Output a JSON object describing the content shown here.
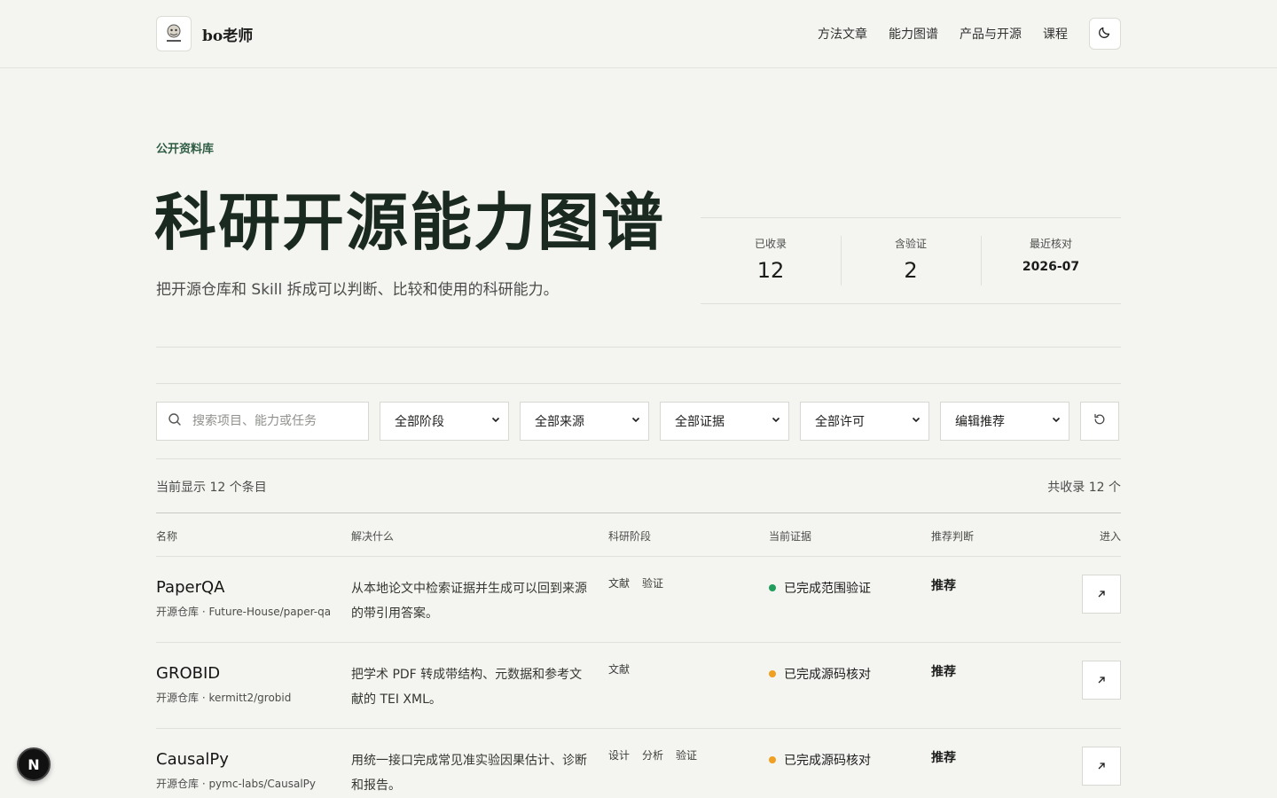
{
  "header": {
    "brand_name": "bo老师",
    "nav": [
      "方法文章",
      "能力图谱",
      "产品与开源",
      "课程"
    ],
    "theme_icon": "moon-icon"
  },
  "hero": {
    "eyebrow": "公开资料库",
    "title": "科研开源能力图谱",
    "subtitle": "把开源仓库和 Skill 拆成可以判断、比较和使用的科研能力。"
  },
  "stats": [
    {
      "label": "已收录",
      "value": "12"
    },
    {
      "label": "含验证",
      "value": "2"
    },
    {
      "label": "最近核对",
      "value": "2026-07"
    }
  ],
  "filters": {
    "search_placeholder": "搜索项目、能力或任务",
    "search_value": "",
    "selects": [
      "全部阶段",
      "全部来源",
      "全部证据",
      "全部许可",
      "编辑推荐"
    ]
  },
  "summary": {
    "showing": "当前显示 12 个条目",
    "total": "共收录 12 个"
  },
  "table": {
    "columns": [
      "名称",
      "解决什么",
      "科研阶段",
      "当前证据",
      "推荐判断",
      "进入"
    ],
    "rows": [
      {
        "name": "PaperQA",
        "meta": "开源仓库 · Future-House/paper-qa",
        "desc": "从本地论文中检索证据并生成可以回到来源的带引用答案。",
        "tags": [
          "文献",
          "验证"
        ],
        "evidence": "已完成范围验证",
        "evidence_color": "#1f9d5b",
        "rec": "推荐"
      },
      {
        "name": "GROBID",
        "meta": "开源仓库 · kermitt2/grobid",
        "desc": "把学术 PDF 转成带结构、元数据和参考文献的 TEI XML。",
        "tags": [
          "文献"
        ],
        "evidence": "已完成源码核对",
        "evidence_color": "#f0a020",
        "rec": "推荐"
      },
      {
        "name": "CausalPy",
        "meta": "开源仓库 · pymc-labs/CausalPy",
        "desc": "用统一接口完成常见准实验因果估计、诊断和报告。",
        "tags": [
          "设计",
          "分析",
          "验证"
        ],
        "evidence": "已完成源码核对",
        "evidence_color": "#f0a020",
        "rec": "推荐"
      }
    ]
  },
  "badge": "N"
}
